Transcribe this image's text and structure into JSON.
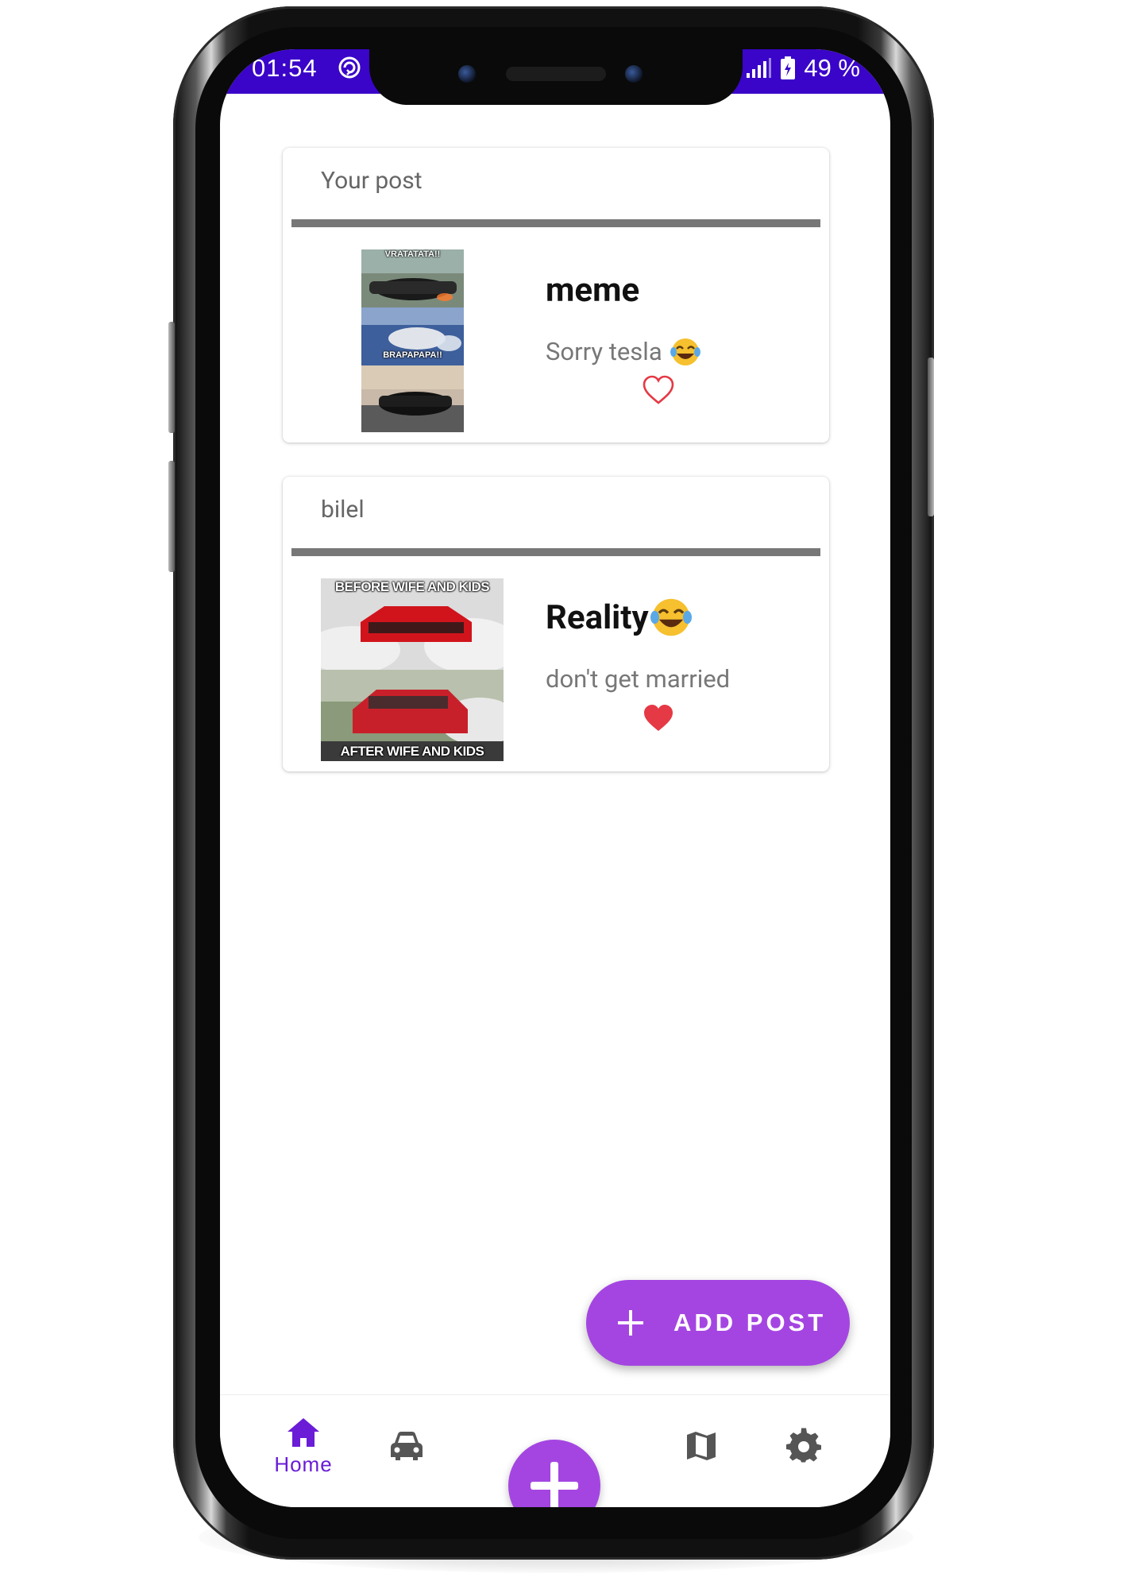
{
  "status_bar": {
    "time": "01:54",
    "battery": "49 %",
    "bg_color": "#3a04c9"
  },
  "posts": [
    {
      "author": "Your post",
      "title": "meme",
      "title_emoji": "",
      "description": "Sorry tesla",
      "description_emoji": "face-with-tears-of-joy",
      "liked": false,
      "image_captions": [
        "VRATATATA!!",
        "BRAPAPAPA!!"
      ]
    },
    {
      "author": "bilel",
      "title": "Reality",
      "title_emoji": "face-with-tears-of-joy",
      "description": "don't get married",
      "description_emoji": "",
      "liked": true,
      "image_captions": [
        "BEFORE WIFE AND KIDS",
        "AFTER WIFE AND KIDS"
      ]
    }
  ],
  "fab": {
    "label": "ADD POST",
    "color": "#a445e1"
  },
  "bottom_nav": {
    "items": [
      {
        "icon": "home-icon",
        "label": "Home",
        "active": true
      },
      {
        "icon": "car-icon",
        "label": "",
        "active": false
      },
      {
        "icon": "add-icon",
        "label": "",
        "active": false
      },
      {
        "icon": "map-icon",
        "label": "",
        "active": false
      },
      {
        "icon": "settings-icon",
        "label": "",
        "active": false
      }
    ],
    "active_color": "#6a1cd6",
    "inactive_color": "#555555"
  },
  "colors": {
    "heart_liked": "#e53945",
    "heart_outline": "#e53945",
    "divider": "#777777"
  }
}
